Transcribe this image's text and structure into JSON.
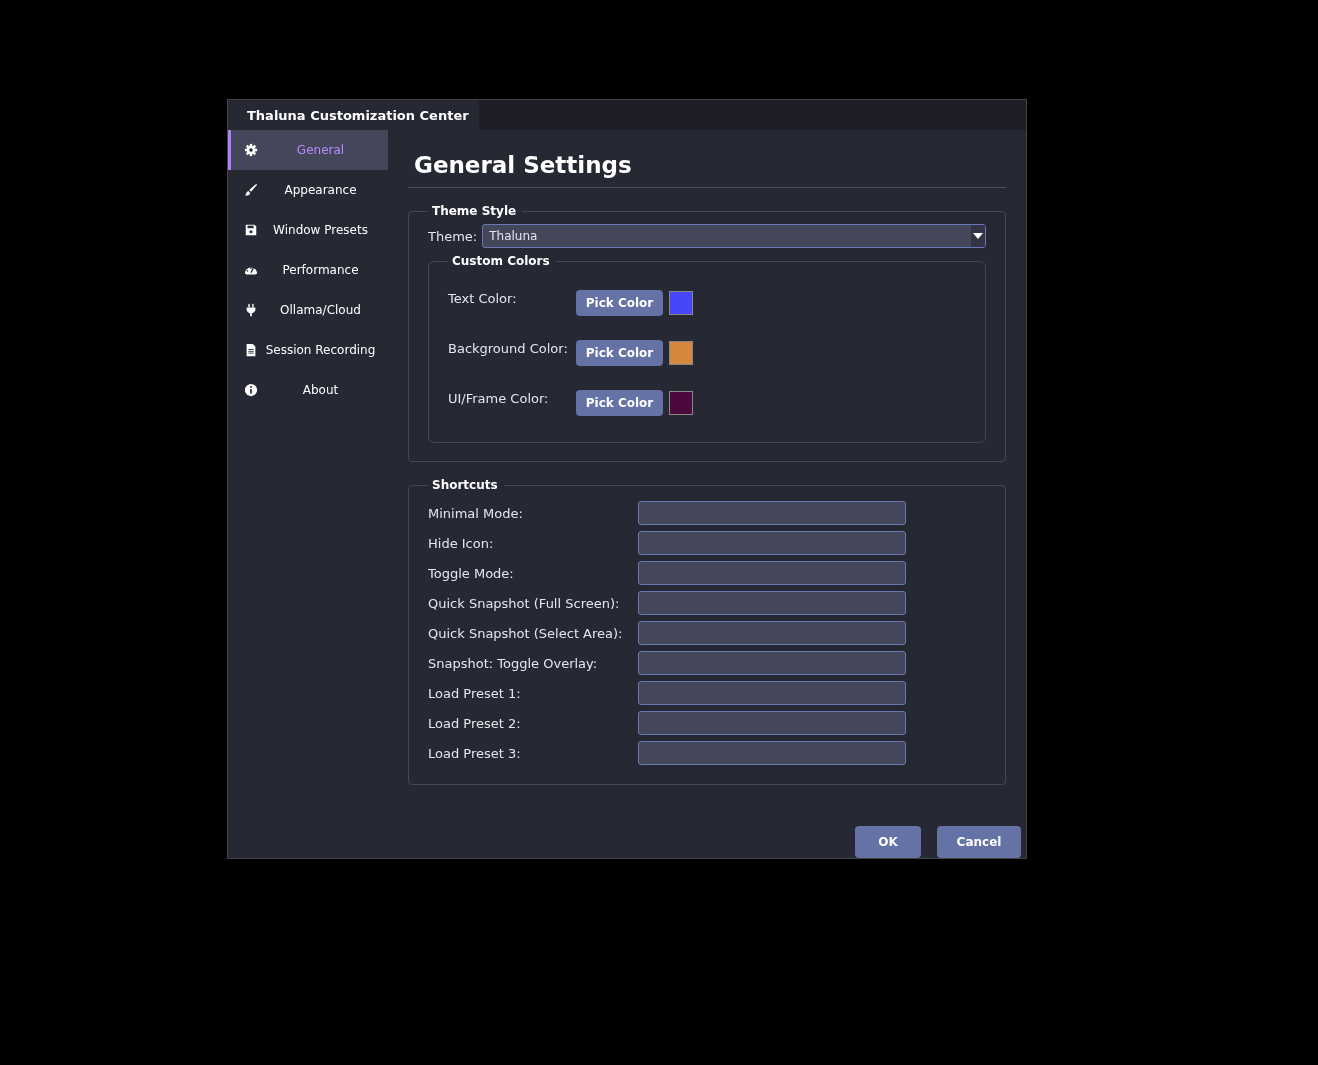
{
  "window": {
    "title": "Thaluna Customization Center"
  },
  "sidebar": {
    "items": [
      {
        "label": "General",
        "selected": true
      },
      {
        "label": "Appearance",
        "selected": false
      },
      {
        "label": "Window Presets",
        "selected": false
      },
      {
        "label": "Performance",
        "selected": false
      },
      {
        "label": "Ollama/Cloud",
        "selected": false
      },
      {
        "label": "Session Recording",
        "selected": false
      },
      {
        "label": "About",
        "selected": false
      }
    ]
  },
  "heading": "General Settings",
  "theme_style": {
    "title": "Theme  Style",
    "theme_label": "Theme:",
    "theme_value": "Thaluna",
    "custom_colors": {
      "title": "Custom Colors",
      "rows": [
        {
          "label": "Text Color:",
          "button": "Pick Color",
          "color": "#4646f8"
        },
        {
          "label": "Background Color:",
          "button": "Pick Color",
          "color": "#d4883c"
        },
        {
          "label": "UI/Frame Color:",
          "button": "Pick Color",
          "color": "#4c0a3c"
        }
      ]
    }
  },
  "shortcuts": {
    "title": "Shortcuts",
    "rows": [
      {
        "label": "Minimal Mode:"
      },
      {
        "label": "Hide Icon:"
      },
      {
        "label": "Toggle Mode:"
      },
      {
        "label": "Quick Snapshot (Full Screen):"
      },
      {
        "label": "Quick Snapshot (Select Area):"
      },
      {
        "label": "Snapshot: Toggle Overlay:"
      },
      {
        "label": "Load Preset 1:"
      },
      {
        "label": "Load Preset 2:"
      },
      {
        "label": "Load Preset 3:"
      }
    ]
  },
  "buttons": [
    "OK",
    "Cancel"
  ]
}
